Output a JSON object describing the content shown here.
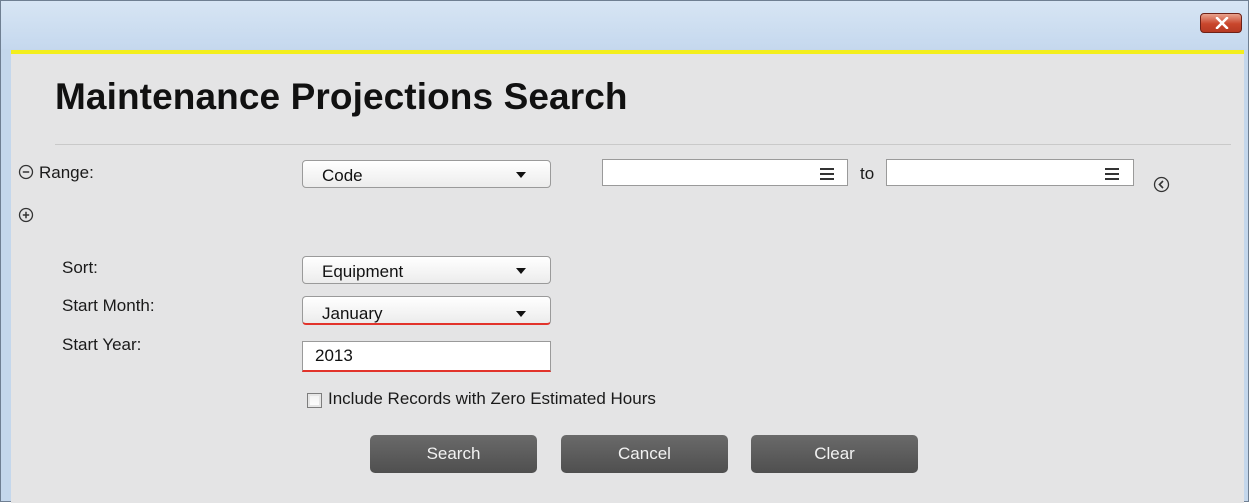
{
  "window": {
    "close_icon": "close-x-icon",
    "accent_color": "#f3ee1d"
  },
  "page": {
    "title": "Maintenance Projections Search"
  },
  "range": {
    "collapse_icon": "minus-circle-icon",
    "add_icon": "plus-circle-icon",
    "label": "Range:",
    "field_select": {
      "value": "Code"
    },
    "from_value": "",
    "to_label": "to",
    "to_value": "",
    "lookup_icon": "list-lookup-icon",
    "nav_icon": "chevron-left-circle-icon"
  },
  "sort": {
    "label": "Sort:",
    "value": "Equipment"
  },
  "start_month": {
    "label": "Start Month:",
    "value": "January"
  },
  "start_year": {
    "label": "Start Year:",
    "value": "2013"
  },
  "options": {
    "include_zero_label": "Include Records with Zero Estimated Hours",
    "include_zero_checked": false
  },
  "buttons": {
    "search": "Search",
    "cancel": "Cancel",
    "clear": "Clear"
  },
  "colors": {
    "required_underline": "#e2332b",
    "button_bg": "#5a5a5a"
  }
}
